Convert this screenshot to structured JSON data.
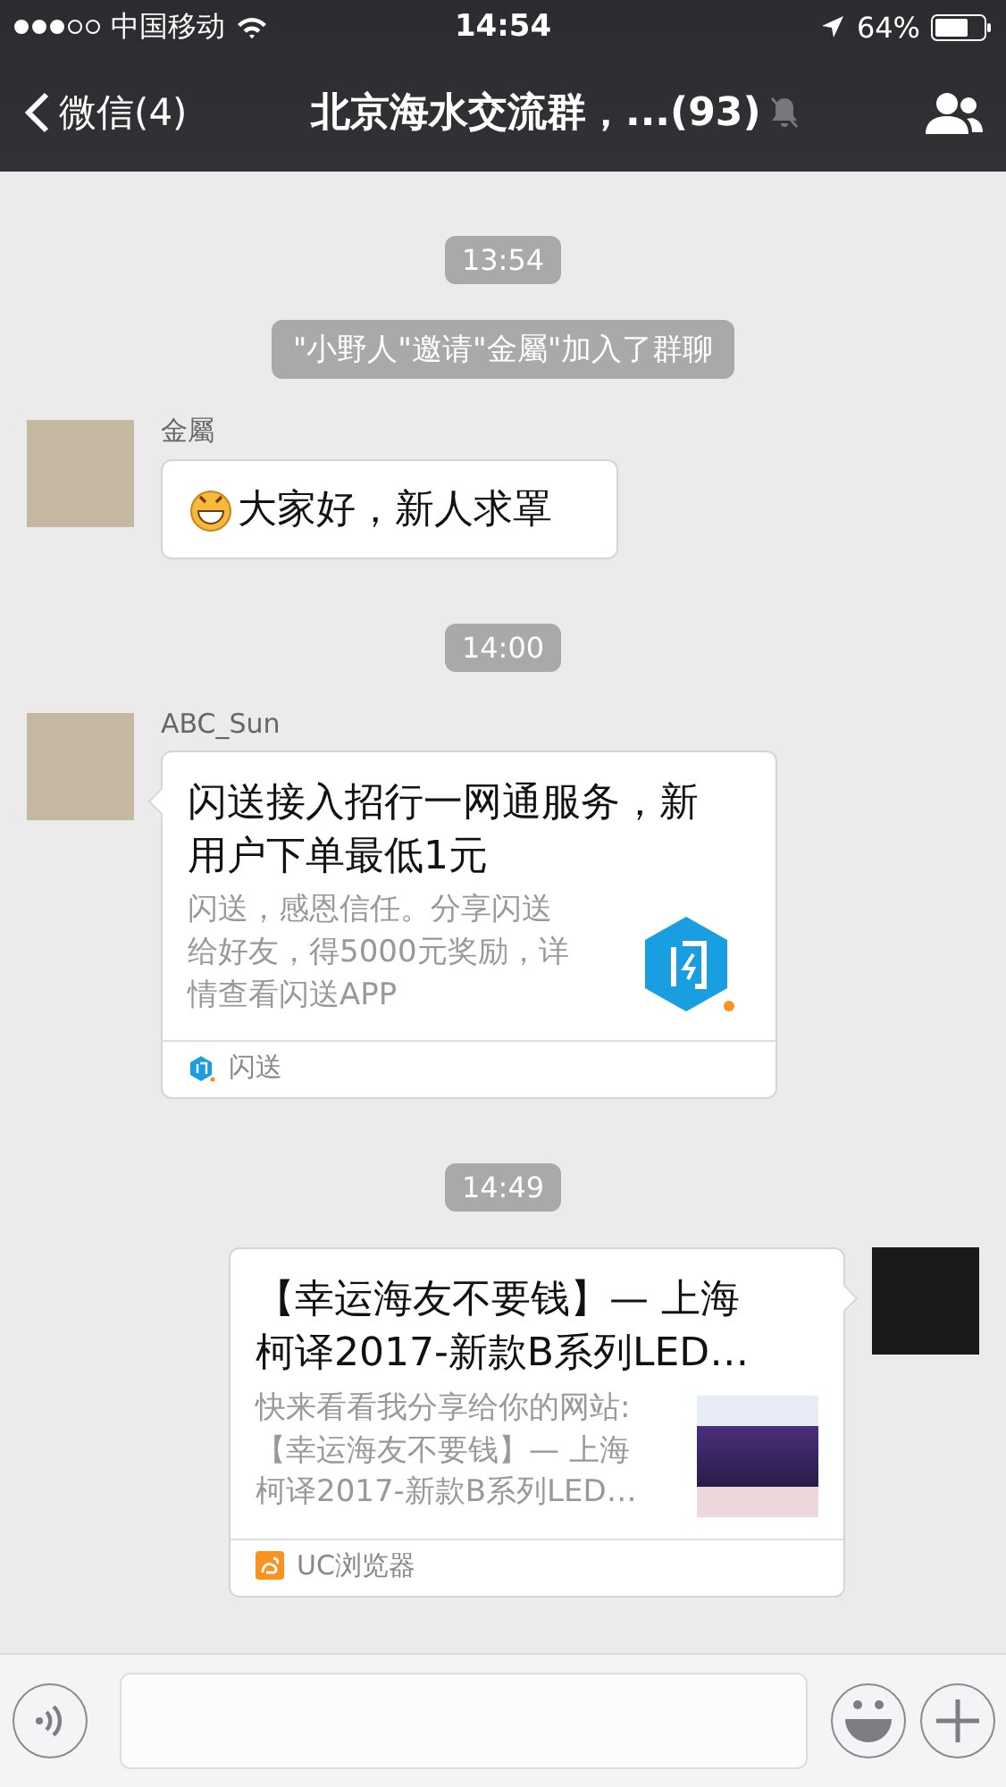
{
  "status_bar": {
    "carrier": "中国移动",
    "time": "14:54",
    "battery": "64%"
  },
  "nav": {
    "back": "微信(4)",
    "title": "北京海水交流群，...(93)",
    "muted": true
  },
  "messages": [
    {
      "kind": "time",
      "text": "13:54"
    },
    {
      "kind": "system",
      "text": "\"小野人\"邀请\"金屬\"加入了群聊"
    },
    {
      "kind": "text",
      "outgoing": false,
      "sender": "金屬",
      "emoji": true,
      "text": "大家好，新人求罩"
    },
    {
      "kind": "time",
      "text": "14:00"
    },
    {
      "kind": "link",
      "outgoing": false,
      "sender": "ABC_Sun",
      "title": "闪送接入招行一网通服务，新用户下单最低1元",
      "desc": "闪送，感恩信任。分享闪送给好友，得5000元奖励，详情查看闪送APP",
      "thumbnail": {
        "kind": "logo"
      },
      "source": {
        "kind": "logo",
        "name": "闪送"
      }
    },
    {
      "kind": "time",
      "text": "14:49"
    },
    {
      "kind": "link",
      "outgoing": true,
      "title": "【幸运海友不要钱】— 上海柯译2017-新款B系列LED…",
      "desc": "快来看看我分享给你的网站:【幸运海友不要钱】— 上海柯译2017-新款B系列LED…",
      "thumbnail": {
        "kind": "photo"
      },
      "source": {
        "kind": "uc",
        "name": "UC浏览器"
      }
    }
  ]
}
